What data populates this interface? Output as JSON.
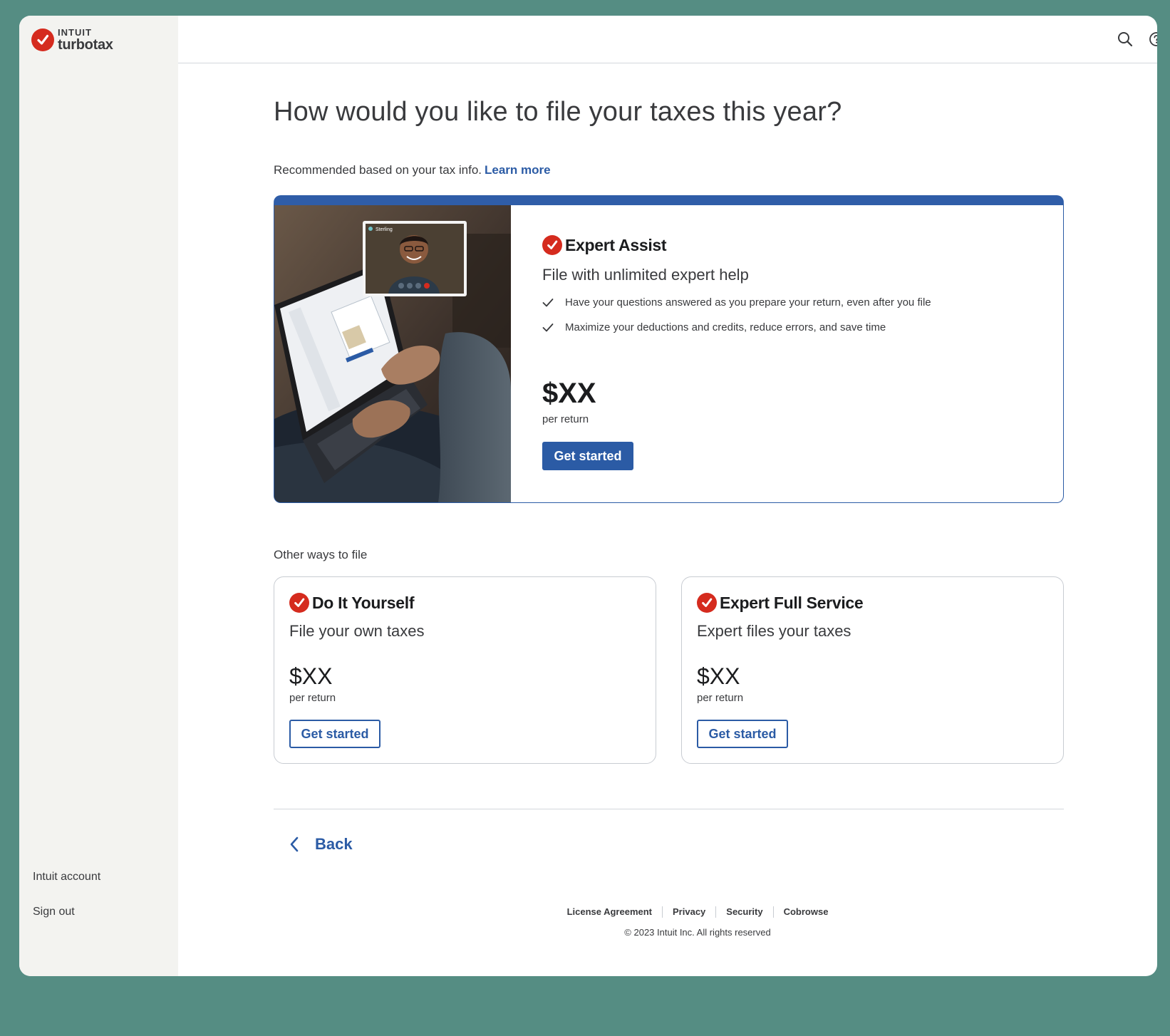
{
  "brand": {
    "company": "INTUIT",
    "product": "turbotax",
    "accent": "#d52b1e",
    "primary": "#2b5ba5"
  },
  "sidebar": {
    "account_label": "Intuit account",
    "signout_label": "Sign out"
  },
  "topbar": {
    "icons": [
      "search-icon",
      "help-icon"
    ]
  },
  "main": {
    "heading": "How would you like to file your taxes this year?",
    "recommend_text": "Recommended based on your tax info.",
    "learn_more": "Learn more",
    "recommended": {
      "title": "Expert Assist",
      "subtitle": "File with unlimited expert help",
      "bullets": [
        "Have your questions answered as you prepare your return, even after you file",
        "Maximize your deductions and credits, reduce errors, and save time"
      ],
      "price": "$XX",
      "price_unit": "per return",
      "cta": "Get started",
      "photo_caption": "Sterling"
    },
    "other_label": "Other ways to file",
    "options": [
      {
        "title": "Do It Yourself",
        "subtitle": "File your own taxes",
        "price": "$XX",
        "price_unit": "per return",
        "cta": "Get started"
      },
      {
        "title": "Expert Full Service",
        "subtitle": "Expert files your taxes",
        "price": "$XX",
        "price_unit": "per return",
        "cta": "Get started"
      }
    ],
    "back_label": "Back"
  },
  "footer": {
    "links": [
      "License Agreement",
      "Privacy",
      "Security",
      "Cobrowse"
    ],
    "copyright": "© 2023 Intuit Inc.  All rights reserved"
  }
}
